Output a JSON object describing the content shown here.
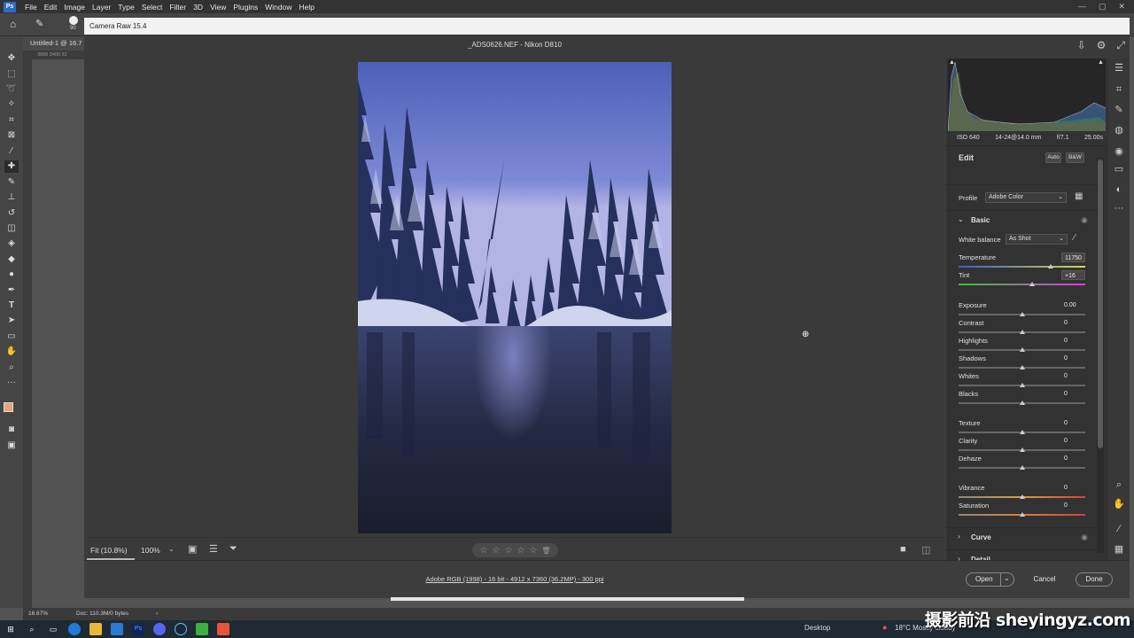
{
  "app": {
    "logo": "Ps"
  },
  "menu": [
    "File",
    "Edit",
    "Image",
    "Layer",
    "Type",
    "Select",
    "Filter",
    "3D",
    "View",
    "Plugins",
    "Window",
    "Help"
  ],
  "window_controls": [
    "—",
    "▢",
    "✕"
  ],
  "options_bar": {
    "brush_size": "90"
  },
  "document_tab": {
    "title": "Untitled-1 @ 16.7"
  },
  "ruler": {
    "marks": "3600  3400  32"
  },
  "camera_raw": {
    "title": "Camera Raw 15.4",
    "file_label": "_ADS0626.NEF  -  Nikon D810",
    "fit_label": "Fit (10.8%)",
    "zoom_label": "100%",
    "stars": [
      "☆",
      "☆",
      "☆",
      "☆",
      "☆"
    ],
    "workflow_info": "Adobe RGB (1998) - 16 bit - 4912 x 7360 (36.2MP) - 300 ppi",
    "buttons": {
      "open": "Open",
      "cancel": "Cancel",
      "done": "Done"
    }
  },
  "panel": {
    "exif": {
      "iso": "ISO 640",
      "lens": "14-24@14.0 mm",
      "aperture": "f/7.1",
      "shutter": "25.00s"
    },
    "edit_label": "Edit",
    "auto_label": "Auto",
    "bw_label": "B&W",
    "profile_label": "Profile",
    "profile_value": "Adobe Color",
    "basic_label": "Basic",
    "wb_label": "White balance",
    "wb_value": "As Shot",
    "sliders": [
      {
        "label": "Temperature",
        "value": "11750",
        "pos": 0.73
      },
      {
        "label": "Tint",
        "value": "+16",
        "pos": 0.58
      },
      {
        "label": "Exposure",
        "value": "0.00",
        "pos": 0.5
      },
      {
        "label": "Contrast",
        "value": "0",
        "pos": 0.5
      },
      {
        "label": "Highlights",
        "value": "0",
        "pos": 0.5
      },
      {
        "label": "Shadows",
        "value": "0",
        "pos": 0.5
      },
      {
        "label": "Whites",
        "value": "0",
        "pos": 0.5
      },
      {
        "label": "Blacks",
        "value": "0",
        "pos": 0.5
      },
      {
        "label": "Texture",
        "value": "0",
        "pos": 0.5
      },
      {
        "label": "Clarity",
        "value": "0",
        "pos": 0.5
      },
      {
        "label": "Dehaze",
        "value": "0",
        "pos": 0.5
      },
      {
        "label": "Vibrance",
        "value": "0",
        "pos": 0.5
      },
      {
        "label": "Saturation",
        "value": "0",
        "pos": 0.5
      }
    ],
    "curve_label": "Curve",
    "detail_label": "Detail"
  },
  "status": {
    "zoom": "16.67%",
    "doc": "Doc: 110.3M/0 bytes"
  },
  "taskbar": {
    "desktop": "Desktop",
    "weather": "18°C  Mostly cloudy"
  },
  "watermark": "摄影前沿 sheyingyz.com"
}
